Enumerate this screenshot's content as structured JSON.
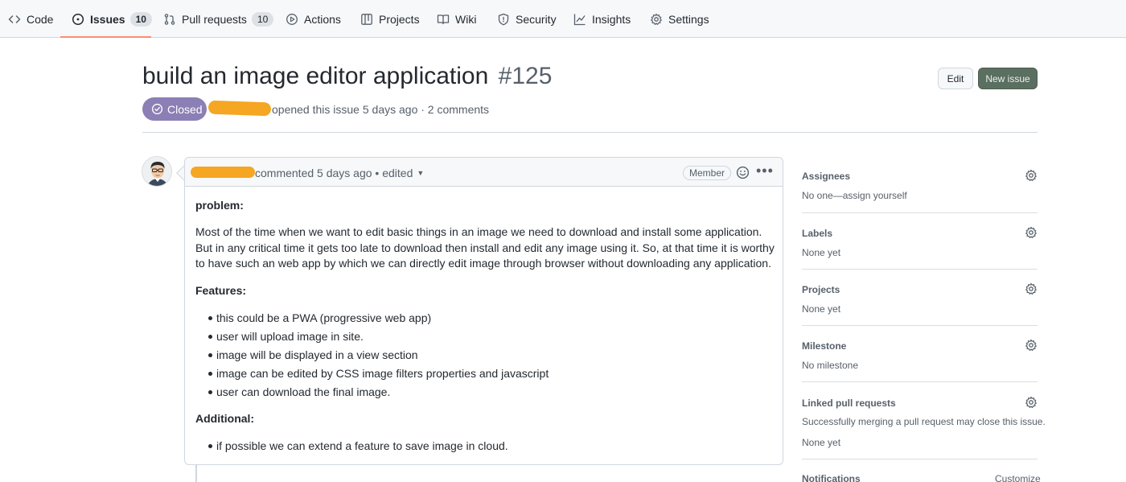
{
  "nav": {
    "tabs": [
      {
        "label": "Code",
        "icon": "code-icon"
      },
      {
        "label": "Issues",
        "icon": "issue-opened-icon",
        "count": "10"
      },
      {
        "label": "Pull requests",
        "icon": "git-pull-request-icon",
        "count": "10"
      },
      {
        "label": "Actions",
        "icon": "play-icon"
      },
      {
        "label": "Projects",
        "icon": "table-icon"
      },
      {
        "label": "Wiki",
        "icon": "book-icon"
      },
      {
        "label": "Security",
        "icon": "shield-icon"
      },
      {
        "label": "Insights",
        "icon": "graph-icon"
      },
      {
        "label": "Settings",
        "icon": "gear-icon"
      }
    ],
    "active_tab": "Issues",
    "active_underline_color": "#fd8c73"
  },
  "issue": {
    "title": "build an image editor application",
    "number": "#125",
    "state": "Closed",
    "state_color": "#8c7fb5",
    "meta": "opened this issue 5 days ago · 2 comments"
  },
  "actions": {
    "edit_label": "Edit",
    "new_issue_label": "New issue"
  },
  "comment": {
    "header": "commented 5 days ago • edited",
    "role_badge": "Member",
    "problem_heading": "problem:",
    "problem_text": "Most of the time when we want to edit basic things in an image we need to download and install some application. But in any critical time it gets too late to download then install and edit any image using it. So, at that time it is worthy to have such an web app by which we can directly edit image through browser without downloading any application.",
    "features_heading": "Features:",
    "features": [
      "this could be a PWA (progressive web app)",
      "user will upload image in site.",
      "image will be displayed in a view section",
      "image can be edited by CSS image filters properties and javascript",
      "user can download the final image."
    ],
    "additional_heading": "Additional:",
    "additional": [
      "if possible we can extend a feature to save image in cloud."
    ]
  },
  "sidebar": {
    "assignees": {
      "label": "Assignees",
      "value": "No one—assign yourself"
    },
    "labels": {
      "label": "Labels",
      "value": "None yet"
    },
    "projects": {
      "label": "Projects",
      "value": "None yet"
    },
    "milestone": {
      "label": "Milestone",
      "value": "No milestone"
    },
    "linked_prs": {
      "label": "Linked pull requests",
      "hint": "Successfully merging a pull request may close this issue.",
      "value": "None yet"
    },
    "notifications": {
      "label": "Notifications",
      "action": "Customize"
    }
  }
}
